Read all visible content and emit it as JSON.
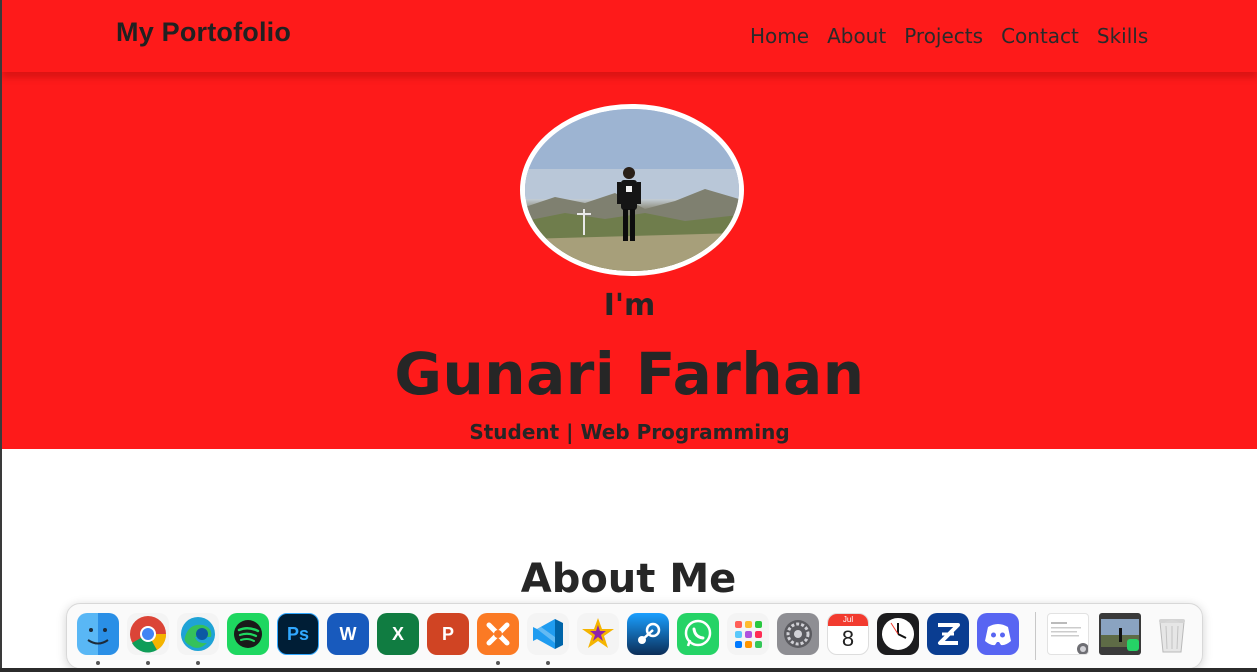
{
  "brand": "My Portofolio",
  "nav": {
    "items": [
      {
        "label": "Home"
      },
      {
        "label": "About"
      },
      {
        "label": "Projects"
      },
      {
        "label": "Contact"
      },
      {
        "label": "Skills"
      }
    ]
  },
  "hero": {
    "greeting": "I'm",
    "name": "Gunari Farhan",
    "role": "Student | Web Programming",
    "background_color": "#fe1a1a"
  },
  "about": {
    "title": "About Me"
  },
  "dock": {
    "apps": [
      {
        "name": "finder-icon",
        "running": true
      },
      {
        "name": "chrome-icon",
        "running": true
      },
      {
        "name": "edge-icon",
        "running": true
      },
      {
        "name": "spotify-icon",
        "running": false
      },
      {
        "name": "photoshop-icon",
        "label": "Ps",
        "running": false
      },
      {
        "name": "word-icon",
        "label": "W",
        "running": false
      },
      {
        "name": "excel-icon",
        "label": "X",
        "running": false
      },
      {
        "name": "powerpoint-icon",
        "label": "P",
        "running": false
      },
      {
        "name": "xampp-icon",
        "running": true
      },
      {
        "name": "vscode-icon",
        "running": true
      },
      {
        "name": "star-app-icon",
        "running": false
      },
      {
        "name": "steam-icon",
        "running": false
      },
      {
        "name": "whatsapp-icon",
        "running": false
      },
      {
        "name": "launchpad-icon",
        "running": false
      },
      {
        "name": "system-settings-icon",
        "running": false
      },
      {
        "name": "calendar-icon",
        "month": "Jul",
        "day": "8",
        "running": false
      },
      {
        "name": "clock-icon",
        "running": false
      },
      {
        "name": "zepeto-icon",
        "running": false
      },
      {
        "name": "discord-icon",
        "running": false
      }
    ],
    "recent": [
      {
        "name": "recent-settings-window-icon"
      },
      {
        "name": "recent-photo-window-icon"
      },
      {
        "name": "trash-icon"
      }
    ]
  }
}
